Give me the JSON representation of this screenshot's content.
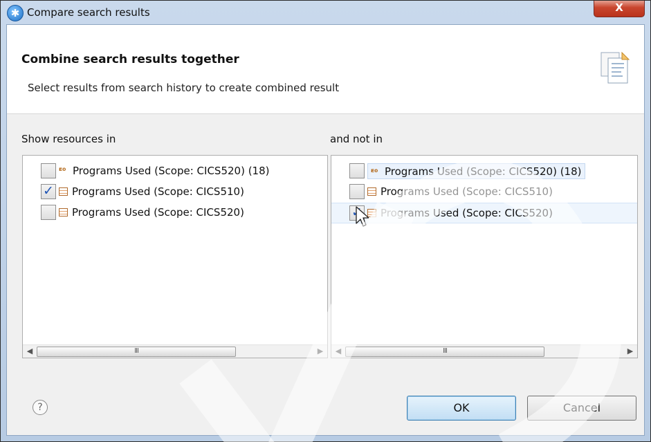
{
  "window": {
    "title": "Compare search results",
    "close_glyph": "X"
  },
  "banner": {
    "heading": "Combine search results together",
    "description": "Select results from search history to create combined result"
  },
  "left_pane": {
    "label": "Show resources in",
    "items": [
      {
        "label": "Programs Used (Scope: CICS520) (18)",
        "icon": "comparison-icon",
        "checked": false
      },
      {
        "label": "Programs Used (Scope: CICS510)",
        "icon": "table-icon",
        "checked": true
      },
      {
        "label": "Programs Used (Scope: CICS520)",
        "icon": "table-icon",
        "checked": false
      }
    ]
  },
  "right_pane": {
    "label": "and not in",
    "items": [
      {
        "label": "Programs Used (Scope: CICS520) (18)",
        "icon": "comparison-icon",
        "checked": false
      },
      {
        "label": "Programs Used (Scope: CICS510)",
        "icon": "table-icon",
        "checked": false
      },
      {
        "label": "Programs Used (Scope: CICS520)",
        "icon": "table-icon",
        "checked": true
      }
    ]
  },
  "scrollbar": {
    "grip": "III"
  },
  "help": {
    "glyph": "?"
  },
  "buttons": {
    "ok": "OK",
    "cancel": "Cancel"
  },
  "glyphs": {
    "check": "✓",
    "arrow_left": "◀",
    "arrow_right": "▶"
  },
  "colors": {
    "accent": "#1f54b4",
    "ok_button": "#c2def4",
    "close_button": "#c9462f"
  }
}
